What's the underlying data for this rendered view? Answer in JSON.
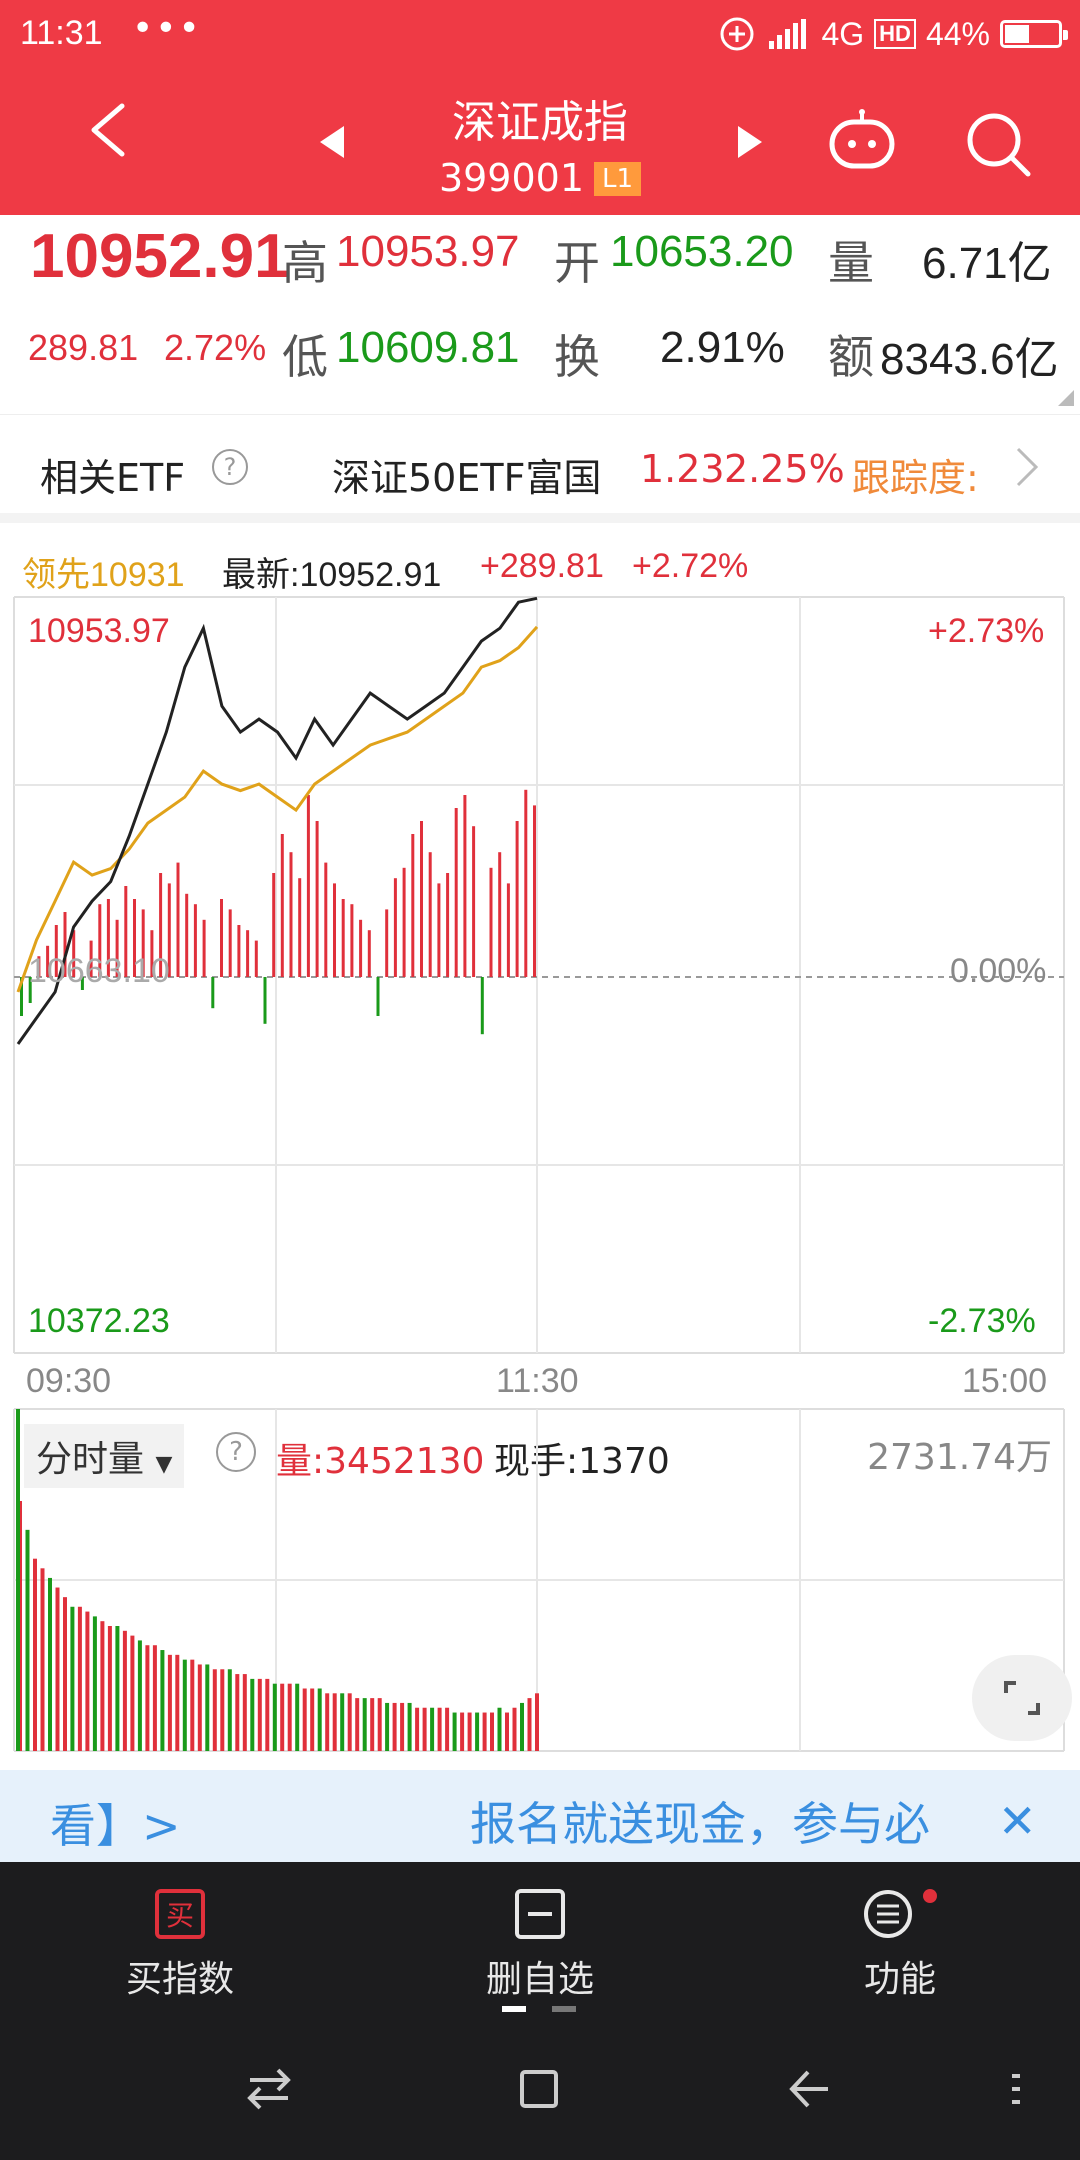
{
  "status_bar": {
    "time": "11:31",
    "more": "•••",
    "network": "4G",
    "hd": "HD",
    "battery": "44%"
  },
  "title_bar": {
    "title": "深证成指",
    "code": "399001",
    "level": "L1"
  },
  "quote": {
    "price": "10952.91",
    "change": "289.81",
    "change_pct": "2.72%",
    "high_label": "高",
    "high": "10953.97",
    "low_label": "低",
    "low": "10609.81",
    "open_label": "开",
    "open": "10653.20",
    "turnover_label": "换",
    "turnover": "2.91%",
    "volume_label": "量",
    "volume": "6.71亿",
    "amount_label": "额",
    "amount": "8343.6亿"
  },
  "etf": {
    "label": "相关ETF",
    "help": "?",
    "name": "深证50ETF富国",
    "price": "1.23",
    "pct": "2.25%",
    "tracking_label": "跟踪度:"
  },
  "chart_legend": {
    "lead": "领先10931",
    "latest": "最新:10952.91",
    "change": "+289.81",
    "change_pct": "+2.72%"
  },
  "chart_labels": {
    "y_top": "10953.97",
    "y_mid": "10663.10",
    "y_bottom": "10372.23",
    "pct_top": "+2.73%",
    "pct_mid": "0.00%",
    "pct_bottom": "-2.73%",
    "x_start": "09:30",
    "x_mid": "11:30",
    "x_end": "15:00"
  },
  "volume_header": {
    "selector": "分时量",
    "help": "?",
    "volume": "量:3452130",
    "current": "现手:1370",
    "amount": "2731.74万"
  },
  "banner": {
    "left": "看】>",
    "middle": "报名就送现金，参与必",
    "close": "✕"
  },
  "actions": {
    "buy": "买指数",
    "buy_icon_char": "买",
    "remove": "删自选",
    "function": "功能"
  },
  "colors": {
    "brand_red": "#ef3a45",
    "up_red": "#e0303b",
    "down_green": "#1a9a1a",
    "avg_line": "#e0a21a",
    "price_line": "#222222"
  },
  "chart_data": {
    "type": "line",
    "title": "",
    "xlabel": "",
    "ylabel": "",
    "x_range": [
      "09:30",
      "15:00"
    ],
    "ylim": [
      10372.23,
      10953.97
    ],
    "base": 10663.1,
    "series": [
      {
        "values": [
          10610,
          10630,
          10650,
          10700,
          10720,
          10735,
          10770,
          10810,
          10850,
          10900,
          10930,
          10870,
          10850,
          10860,
          10850,
          10830,
          10860,
          10840,
          10860,
          10880,
          10870,
          10860,
          10870,
          10880,
          10900,
          10920,
          10930,
          10950,
          10953
        ]
      },
      {
        "values": [
          10650,
          10690,
          10720,
          10750,
          10740,
          10745,
          10760,
          10780,
          10790,
          10800,
          10820,
          10810,
          10805,
          10810,
          10800,
          10790,
          10810,
          10820,
          10830,
          10840,
          10845,
          10850,
          10860,
          10870,
          10880,
          10900,
          10905,
          10915,
          10931
        ]
      }
    ],
    "volume_bars": [
      52,
      46,
      40,
      38,
      36,
      34,
      32,
      30,
      30,
      29,
      28,
      27,
      26,
      26,
      25,
      24,
      23,
      22,
      22,
      21,
      20,
      20,
      19,
      19,
      18,
      18,
      17,
      17,
      17,
      16,
      16,
      15,
      15,
      15,
      14,
      14,
      14,
      14,
      13,
      13,
      13,
      12,
      12,
      12,
      12,
      11,
      11,
      11,
      11,
      10,
      10,
      10,
      10,
      9,
      9,
      9,
      9,
      9,
      8,
      8,
      8,
      8,
      8,
      8,
      9,
      8,
      9,
      10,
      11,
      12
    ],
    "diff_bars": [
      -15,
      -10,
      8,
      12,
      20,
      25,
      18,
      -5,
      14,
      28,
      30,
      22,
      35,
      30,
      26,
      18,
      40,
      36,
      44,
      32,
      28,
      22,
      -12,
      30,
      26,
      20,
      18,
      14,
      -18,
      40,
      55,
      48,
      38,
      70,
      60,
      44,
      36,
      30,
      28,
      22,
      18,
      -15,
      26,
      38,
      42,
      55,
      60,
      48,
      36,
      40,
      65,
      70,
      58,
      -22,
      42,
      48,
      36,
      60,
      72,
      66
    ]
  }
}
